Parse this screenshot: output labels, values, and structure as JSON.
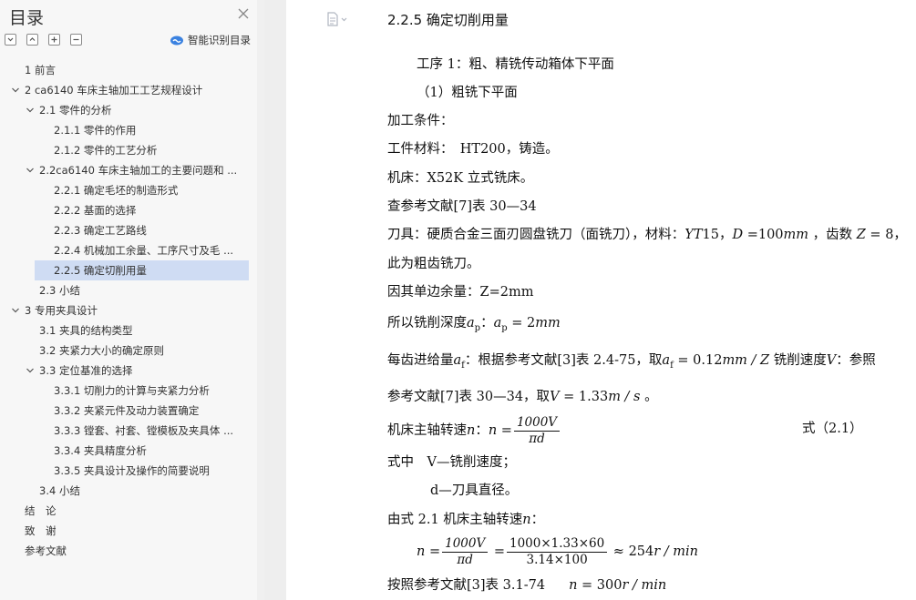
{
  "sidebar": {
    "title": "目录",
    "smart_toc_label": "智能识别目录",
    "items": [
      {
        "label": "1 前言",
        "level": 1,
        "expandable": false
      },
      {
        "label": "2 ca6140 车床主轴加工工艺规程设计",
        "level": 1,
        "expandable": true
      },
      {
        "label": "2.1 零件的分析",
        "level": 2,
        "expandable": true
      },
      {
        "label": "2.1.1 零件的作用",
        "level": 3,
        "expandable": false
      },
      {
        "label": "2.1.2 零件的工艺分析",
        "level": 3,
        "expandable": false
      },
      {
        "label": "2.2ca6140 车床主轴加工的主要问题和 ...",
        "level": 2,
        "expandable": true
      },
      {
        "label": "2.2.1 确定毛坯的制造形式",
        "level": 3,
        "expandable": false
      },
      {
        "label": "2.2.2 基面的选择",
        "level": 3,
        "expandable": false
      },
      {
        "label": "2.2.3 确定工艺路线",
        "level": 3,
        "expandable": false
      },
      {
        "label": "2.2.4 机械加工余量、工序尺寸及毛 ...",
        "level": 3,
        "expandable": false
      },
      {
        "label": "2.2.5 确定切削用量",
        "level": 3,
        "expandable": false,
        "selected": true
      },
      {
        "label": "2.3 小结",
        "level": 2,
        "expandable": false
      },
      {
        "label": "3 专用夹具设计",
        "level": 1,
        "expandable": true
      },
      {
        "label": "3.1 夹具的结构类型",
        "level": 2,
        "expandable": false
      },
      {
        "label": "3.2 夹紧力大小的确定原则",
        "level": 2,
        "expandable": false
      },
      {
        "label": "3.3 定位基准的选择",
        "level": 2,
        "expandable": true
      },
      {
        "label": "3.3.1 切削力的计算与夹紧力分析",
        "level": 3,
        "expandable": false
      },
      {
        "label": "3.3.2 夹紧元件及动力装置确定",
        "level": 3,
        "expandable": false
      },
      {
        "label": "3.3.3 镗套、衬套、镗模板及夹具体 ...",
        "level": 3,
        "expandable": false
      },
      {
        "label": "3.3.4 夹具精度分析",
        "level": 3,
        "expandable": false
      },
      {
        "label": "3.3.5 夹具设计及操作的简要说明",
        "level": 3,
        "expandable": false
      },
      {
        "label": "3.4 小结",
        "level": 2,
        "expandable": false
      },
      {
        "label": "结　论",
        "level": 1,
        "expandable": false
      },
      {
        "label": "致　谢",
        "level": 1,
        "expandable": false
      },
      {
        "label": "参考文献",
        "level": 1,
        "expandable": false
      }
    ]
  },
  "document": {
    "heading": "2.2.5 确定切削用量",
    "l1": "工序 1：粗、精铣传动箱体下平面",
    "l2": "（1）粗铣下平面",
    "l3": "加工条件：",
    "l4": "工件材料：　HT200，铸造。",
    "l5": "机床：X52K 立式铣床。",
    "l6": "查参考文献[7]表 30—34",
    "l7a": "刀具：硬质合金三面刃圆盘铣刀（面铣刀），材料：",
    "l7b": "YT",
    "l7c": "15，",
    "l7d": "D",
    "l7e": " =100",
    "l7f": "mm",
    "l7g": " ，齿数 ",
    "l7h": "Z",
    "l7i": " = 8，",
    "l8": "此为粗齿铣刀。",
    "l9": "因其单边余量：Z=2mm",
    "l10a": "所以铣削深度",
    "l10b": "a",
    "l10c": "p",
    "l10d": "：",
    "l10e": "a",
    "l10f": "p",
    "l10g": " = 2",
    "l10h": "mm",
    "l11a": "每齿进给量",
    "l11b": "a",
    "l11c": "f",
    "l11d": "：根据参考文献[3]表 2.4-75，取",
    "l11e": "a",
    "l11f": "f",
    "l11g": " = 0.12",
    "l11h": "mm / Z",
    "l11i": " 铣削速度",
    "l11j": "V",
    "l11k": "：参照",
    "l12a": "参考文献[7]表 30—34，取",
    "l12b": "V",
    "l12c": " = 1.33",
    "l12d": "m / s",
    "l12e": " 。",
    "l13a": "机床主轴转速",
    "l13b": "n",
    "l13c": "：",
    "l13d": "n",
    "l13e": " =",
    "l13num": "1000V",
    "l13den": "πd",
    "l13eq": "式（2.1）",
    "l14": "式中　V—铣削速度；",
    "l15": "d—刀具直径。",
    "l16a": "由式 2.1 机床主轴转速",
    "l16b": "n",
    "l16c": "：",
    "l17a": "n",
    "l17b": " =",
    "l17num1": "1000V",
    "l17den1": "πd",
    "l17c": " =",
    "l17num2": "1000×1.33×60",
    "l17den2": "3.14×100",
    "l17d": " ≈ 254",
    "l17e": "r / min",
    "l18a": "按照参考文献[3]表 3.1-74",
    "l18b": "n",
    "l18c": " = 300",
    "l18d": "r / min"
  }
}
